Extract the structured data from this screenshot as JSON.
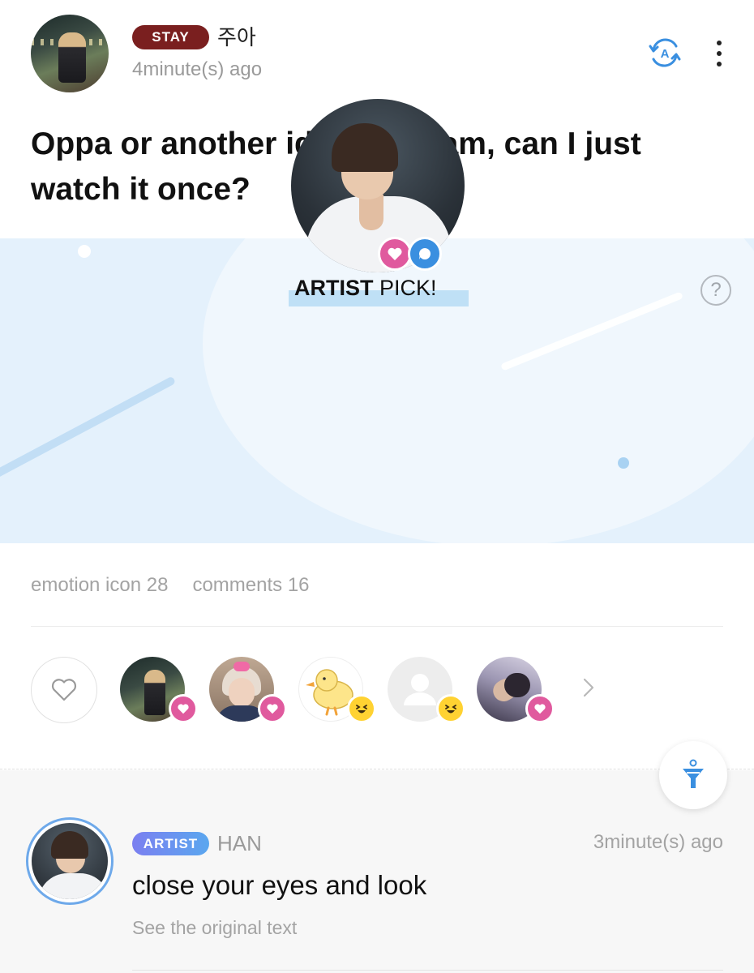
{
  "post": {
    "author_badge": "STAY",
    "author_name": "주아",
    "time": "4minute(s) ago",
    "title": "Oppa or another idol’s fancam, can I just watch it once?",
    "translate_icon_letter": "A"
  },
  "artist_pick": {
    "label_bold": "ARTIST",
    "label_rest": " PICK!",
    "help_symbol": "?",
    "reactions": [
      "heart-icon",
      "comment-icon"
    ]
  },
  "stats": {
    "emotion": "emotion icon 28",
    "comments": "comments 16"
  },
  "reactors": [
    {
      "avatar": "night-street-photo",
      "badge": "heart-icon"
    },
    {
      "avatar": "pink-bow-photo",
      "badge": "heart-icon"
    },
    {
      "avatar": "yellow-duck-sticker",
      "badge": "laugh-emoji-icon"
    },
    {
      "avatar": "default-profile-icon",
      "badge": "laugh-emoji-icon"
    },
    {
      "avatar": "lying-down-photo",
      "badge": "heart-icon"
    }
  ],
  "comment": {
    "badge": "ARTIST",
    "author": "HAN",
    "time": "3minute(s) ago",
    "text": "close your eyes and look",
    "see_original": "See the original text"
  },
  "colors": {
    "stay_badge": "#7a1f1f",
    "accent_blue": "#3a8fe0",
    "heart_pink": "#e05a9e",
    "banner_bg": "#e4f1fc",
    "laugh_yellow": "#ffd232"
  }
}
